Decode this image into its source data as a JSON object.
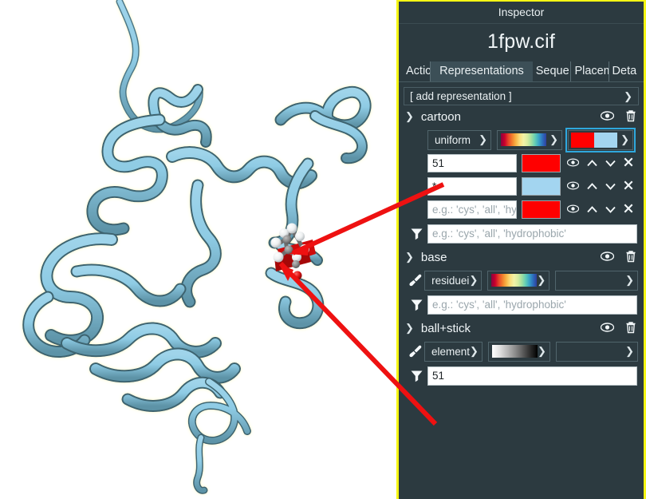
{
  "viewport": {
    "name": "molecular-3d-viewport",
    "background": "#ffffff",
    "cartoon_color": "#8ecbe4",
    "cartoon_edge_color": "#3d646f",
    "highlight_color": "#d40000",
    "atom_carbon_color": "#808080",
    "atom_hydrogen_color": "#f2f2f2",
    "atom_oxygen_color": "#d40000"
  },
  "annotation": {
    "arrow_color": "#ee1111",
    "arrow_count": 2
  },
  "inspector": {
    "border_color": "#f5f514",
    "panel_title": "Inspector",
    "file_title": "1fpw.cif",
    "tabs": [
      {
        "label": "Actic",
        "full": "Actions",
        "active": false
      },
      {
        "label": "Representations",
        "full": "Representations",
        "active": true
      },
      {
        "label": "Seque",
        "full": "Sequence",
        "active": false
      },
      {
        "label": "Placem",
        "full": "Placement",
        "active": false
      },
      {
        "label": "Deta",
        "full": "Details",
        "active": false
      }
    ],
    "add_representation": {
      "label": "[ add representation ]",
      "caret_icon": "chevron-down-icon"
    },
    "representations": [
      {
        "name": "cartoon",
        "caret_icon": "chevron-down-icon",
        "eye_icon": "eye-icon",
        "trash_icon": "trash-icon",
        "color_mode": "uniform",
        "gradient": "spectral",
        "swatch_colors": [
          "#ff0000",
          "#a3d5f0"
        ],
        "swatch_focused": true,
        "selection_rows": [
          {
            "value": "51",
            "placeholder": "e.g.: 'cys', 'all', 'hydrophobic'",
            "color": "#ff0000",
            "is_placeholder": false
          },
          {
            "value": "*",
            "placeholder": "e.g.: 'cys', 'all', 'hydrophobic'",
            "color": "#a3d5f0",
            "is_placeholder": false
          },
          {
            "value": "",
            "placeholder": "e.g.: 'cys', 'all', 'hydrophobic'",
            "color": "#ff0000",
            "is_placeholder": true
          }
        ],
        "filter": {
          "value": "",
          "placeholder": "e.g.: 'cys', 'all', 'hydrophobic'",
          "is_placeholder": true,
          "icon": "funnel-icon"
        }
      },
      {
        "name": "base",
        "caret_icon": "chevron-down-icon",
        "eye_icon": "eye-icon",
        "trash_icon": "trash-icon",
        "color_mode": "residuei",
        "color_mode_full": "residueindex",
        "gradient": "spectral",
        "blank_combo": "",
        "filter": {
          "value": "",
          "placeholder": "e.g.: 'cys', 'all', 'hydrophobic'",
          "is_placeholder": true,
          "icon": "funnel-icon"
        }
      },
      {
        "name": "ball+stick",
        "caret_icon": "chevron-down-icon",
        "eye_icon": "eye-icon",
        "trash_icon": "trash-icon",
        "color_mode": "element",
        "gradient": "grayscale",
        "blank_combo": "",
        "filter": {
          "value": "51",
          "placeholder": "e.g.: 'cys', 'all', 'hydrophobic'",
          "is_placeholder": false,
          "icon": "funnel-icon"
        }
      }
    ],
    "row_icons": {
      "eye": "eye-icon",
      "up": "chevron-up-icon",
      "down": "chevron-down-icon",
      "remove": "close-x-icon",
      "brush": "paintbrush-icon",
      "funnel": "funnel-icon"
    }
  }
}
